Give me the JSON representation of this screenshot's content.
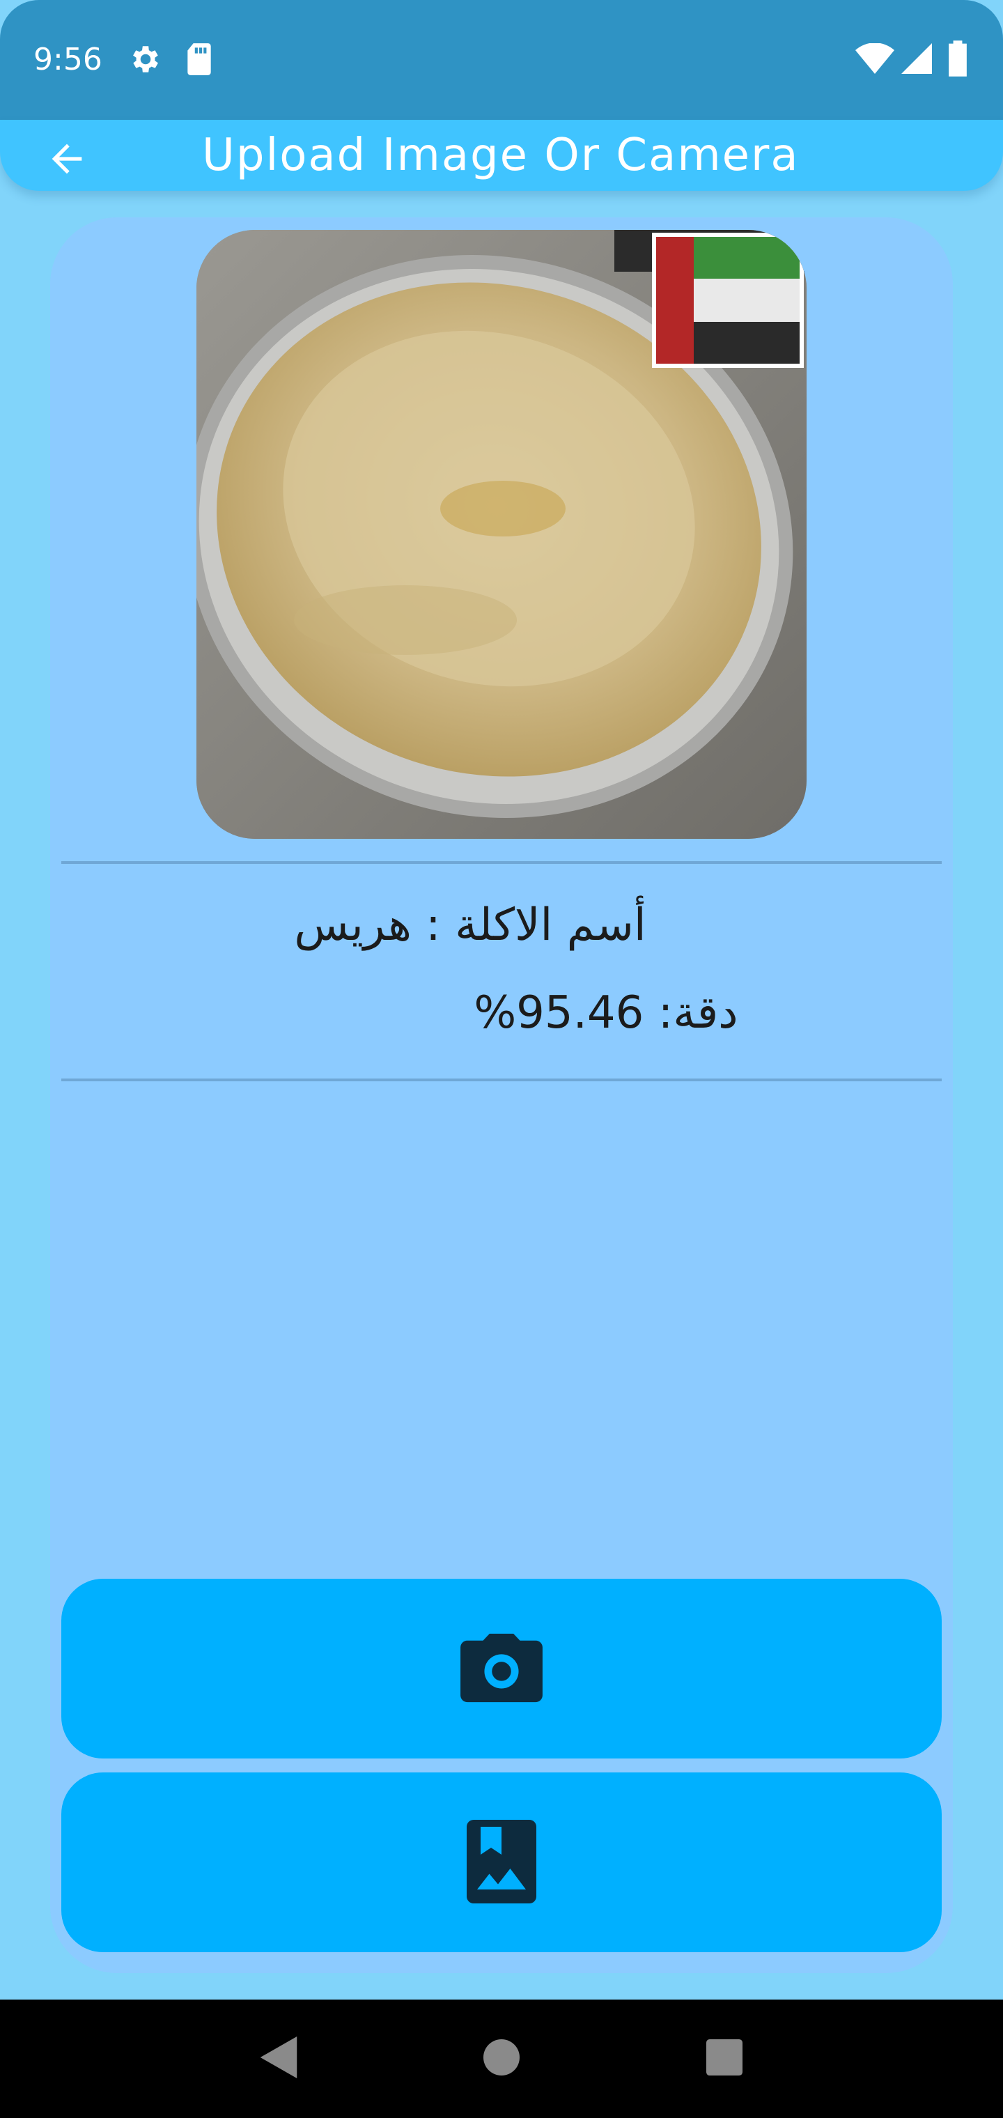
{
  "status_bar": {
    "time": "9:56",
    "icons": [
      "gear-icon",
      "sd-card-icon",
      "wifi-icon",
      "cell-signal-icon",
      "battery-icon"
    ]
  },
  "app_bar": {
    "title": "Upload Image Or Camera",
    "back_icon": "arrow-back-icon"
  },
  "result": {
    "name_line": "أسم الاكلة  :  هريس",
    "accuracy_line": "دقة: 95.46%"
  },
  "buttons": {
    "camera_icon": "camera-icon",
    "gallery_icon": "photo-album-icon"
  },
  "nav_bar": {
    "icons": [
      "back-triangle-icon",
      "home-circle-icon",
      "recents-square-icon"
    ]
  },
  "colors": {
    "status_bar": "#2f93c4",
    "app_bar": "#40c4ff",
    "background": "#81d4fa",
    "card": "#8ccbff",
    "button": "#00b0ff",
    "button_icon": "#0d2b3e"
  }
}
